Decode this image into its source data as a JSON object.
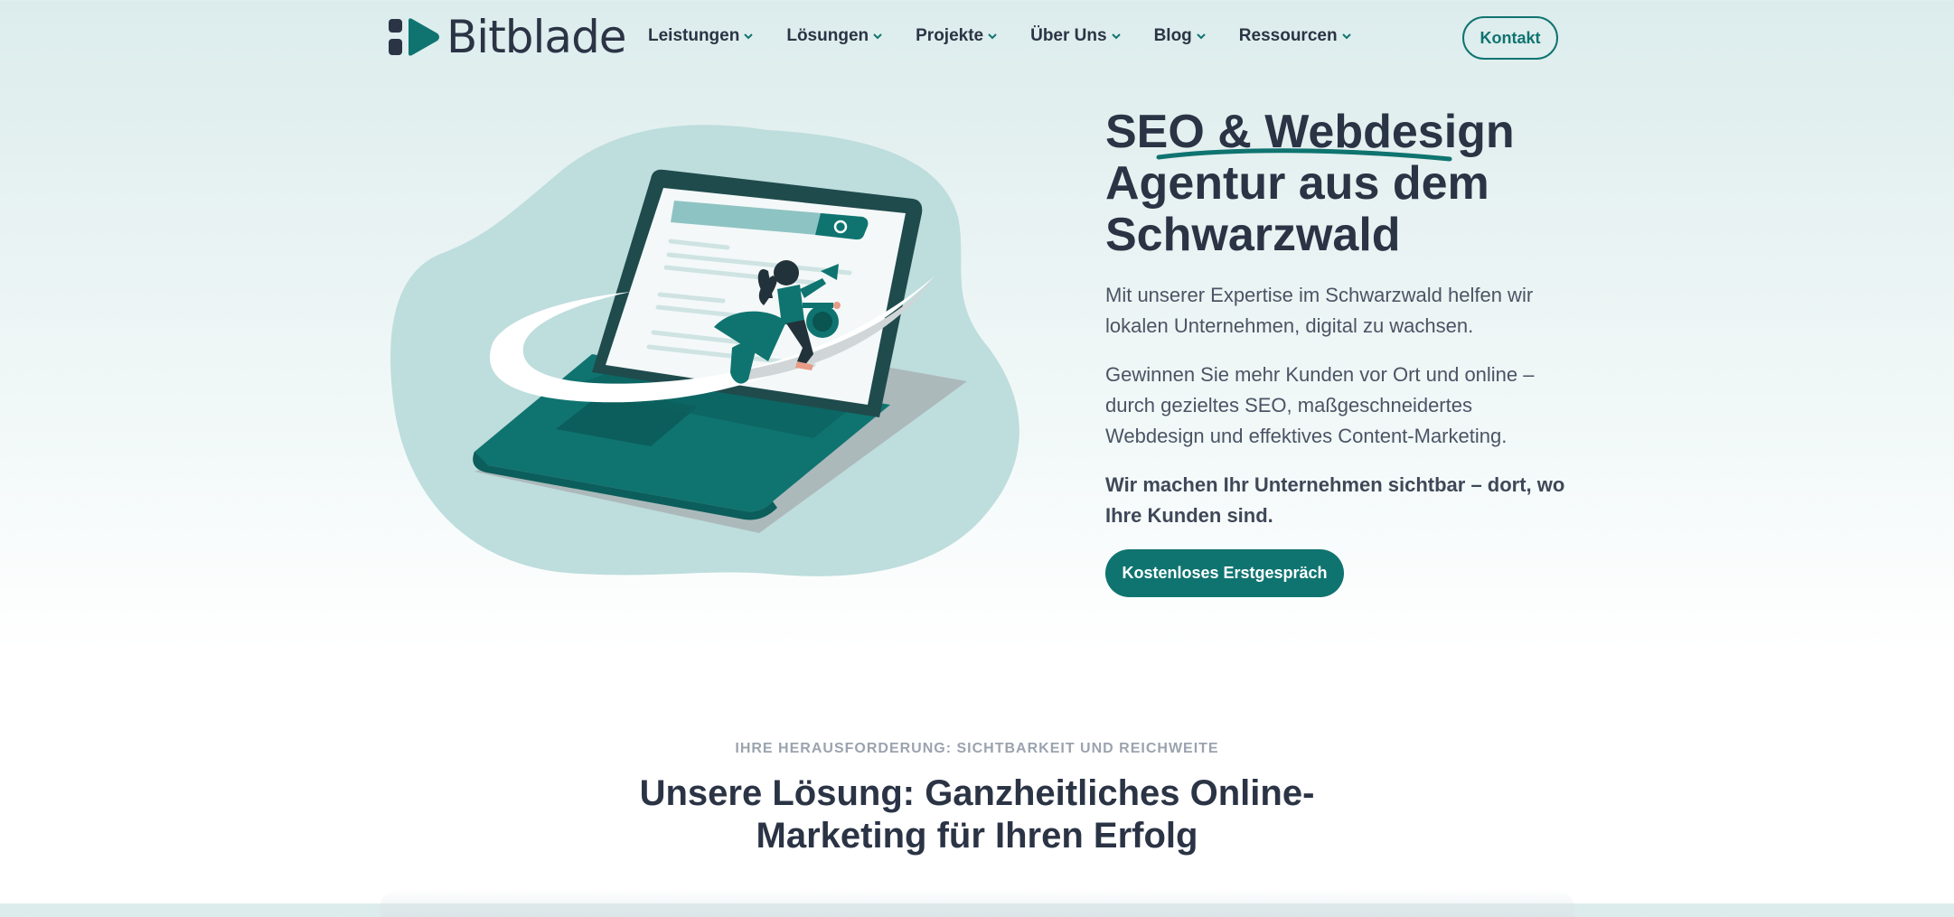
{
  "brand": {
    "name": "Bitblade",
    "accent": "#0f7470",
    "dark": "#2b3445"
  },
  "nav": {
    "items": [
      {
        "label": "Leistungen"
      },
      {
        "label": "Lösungen"
      },
      {
        "label": "Projekte"
      },
      {
        "label": "Über Uns"
      },
      {
        "label": "Blog"
      },
      {
        "label": "Ressourcen"
      }
    ],
    "contact_label": "Kontakt"
  },
  "hero": {
    "title_line1": "SEO & Webdesign",
    "title_line2": "Agentur aus dem",
    "title_line3": "Schwarzwald",
    "paragraph1": "Mit unserer Expertise im Schwarzwald helfen wir lokalen Unternehmen, digital zu wachsen.",
    "paragraph2": "Gewinnen Sie mehr Kunden vor Ort und online – durch gezieltes SEO, maßgeschneidertes Webdesign und effektives Content-Marketing.",
    "paragraph3": "Wir machen Ihr Unternehmen sichtbar – dort, wo Ihre Kunden sind.",
    "cta_label": "Kostenloses Erstgespräch",
    "illustration_icon": "laptop-rocket-illustration"
  },
  "section": {
    "eyebrow": "IHRE HERAUSFORDERUNG: SICHTBARKEIT UND REICHWEITE",
    "title": "Unsere Lösung: Ganzheitliches Online-Marketing für Ihren Erfolg"
  },
  "icons": {
    "chevron": "chevron-down-icon",
    "search": "search-icon",
    "megaphone": "megaphone-icon"
  }
}
